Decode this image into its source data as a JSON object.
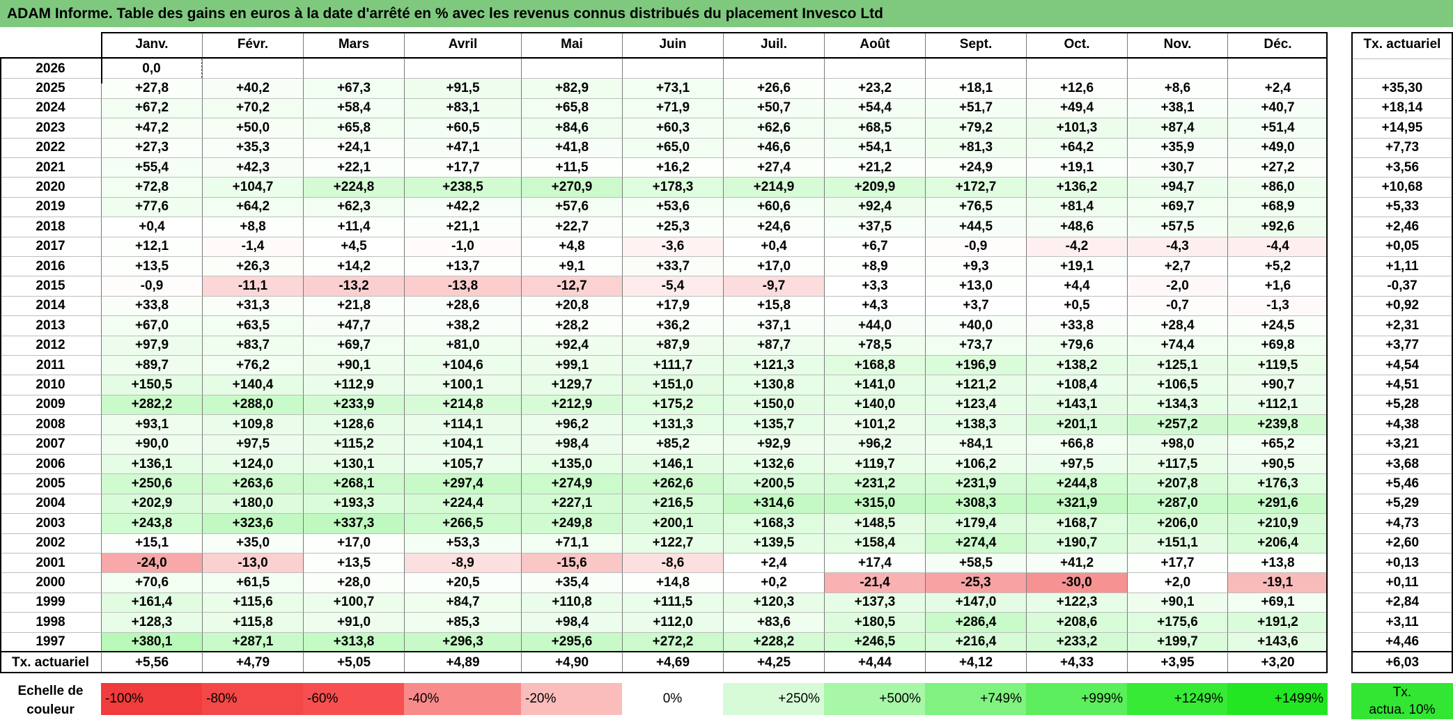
{
  "title": "ADAM Informe. Table des gains en euros à la date d'arrêté en % avec les revenus connus distribués du placement Invesco Ltd",
  "months": [
    "Janv.",
    "Févr.",
    "Mars",
    "Avril",
    "Mai",
    "Juin",
    "Juil.",
    "Août",
    "Sept.",
    "Oct.",
    "Nov.",
    "Déc."
  ],
  "rate_header": "Tx. actuariel",
  "rows": [
    {
      "year": "2026",
      "values": [
        "0,0",
        "",
        "",
        "",
        "",
        "",
        "",
        "",
        "",
        "",
        "",
        ""
      ],
      "rate": ""
    },
    {
      "year": "2025",
      "values": [
        "+27,8",
        "+40,2",
        "+67,3",
        "+91,5",
        "+82,9",
        "+73,1",
        "+26,6",
        "+23,2",
        "+18,1",
        "+12,6",
        "+8,6",
        "+2,4"
      ],
      "rate": "+35,30"
    },
    {
      "year": "2024",
      "values": [
        "+67,2",
        "+70,2",
        "+58,4",
        "+83,1",
        "+65,8",
        "+71,9",
        "+50,7",
        "+54,4",
        "+51,7",
        "+49,4",
        "+38,1",
        "+40,7"
      ],
      "rate": "+18,14"
    },
    {
      "year": "2023",
      "values": [
        "+47,2",
        "+50,0",
        "+65,8",
        "+60,5",
        "+84,6",
        "+60,3",
        "+62,6",
        "+68,5",
        "+79,2",
        "+101,3",
        "+87,4",
        "+51,4"
      ],
      "rate": "+14,95"
    },
    {
      "year": "2022",
      "values": [
        "+27,3",
        "+35,3",
        "+24,1",
        "+47,1",
        "+41,8",
        "+65,0",
        "+46,6",
        "+54,1",
        "+81,3",
        "+64,2",
        "+35,9",
        "+49,0"
      ],
      "rate": "+7,73"
    },
    {
      "year": "2021",
      "values": [
        "+55,4",
        "+42,3",
        "+22,1",
        "+17,7",
        "+11,5",
        "+16,2",
        "+27,4",
        "+21,2",
        "+24,9",
        "+19,1",
        "+30,7",
        "+27,2"
      ],
      "rate": "+3,56"
    },
    {
      "year": "2020",
      "values": [
        "+72,8",
        "+104,7",
        "+224,8",
        "+238,5",
        "+270,9",
        "+178,3",
        "+214,9",
        "+209,9",
        "+172,7",
        "+136,2",
        "+94,7",
        "+86,0"
      ],
      "rate": "+10,68"
    },
    {
      "year": "2019",
      "values": [
        "+77,6",
        "+64,2",
        "+62,3",
        "+42,2",
        "+57,6",
        "+53,6",
        "+60,6",
        "+92,4",
        "+76,5",
        "+81,4",
        "+69,7",
        "+68,9"
      ],
      "rate": "+5,33"
    },
    {
      "year": "2018",
      "values": [
        "+0,4",
        "+8,8",
        "+11,4",
        "+21,1",
        "+22,7",
        "+25,3",
        "+24,6",
        "+37,5",
        "+44,5",
        "+48,6",
        "+57,5",
        "+92,6"
      ],
      "rate": "+2,46"
    },
    {
      "year": "2017",
      "values": [
        "+12,1",
        "-1,4",
        "+4,5",
        "-1,0",
        "+4,8",
        "-3,6",
        "+0,4",
        "+6,7",
        "-0,9",
        "-4,2",
        "-4,3",
        "-4,4"
      ],
      "rate": "+0,05"
    },
    {
      "year": "2016",
      "values": [
        "+13,5",
        "+26,3",
        "+14,2",
        "+13,7",
        "+9,1",
        "+33,7",
        "+17,0",
        "+8,9",
        "+9,3",
        "+19,1",
        "+2,7",
        "+5,2"
      ],
      "rate": "+1,11"
    },
    {
      "year": "2015",
      "values": [
        "-0,9",
        "-11,1",
        "-13,2",
        "-13,8",
        "-12,7",
        "-5,4",
        "-9,7",
        "+3,3",
        "+13,0",
        "+4,4",
        "-2,0",
        "+1,6"
      ],
      "rate": "-0,37"
    },
    {
      "year": "2014",
      "values": [
        "+33,8",
        "+31,3",
        "+21,8",
        "+28,6",
        "+20,8",
        "+17,9",
        "+15,8",
        "+4,3",
        "+3,7",
        "+0,5",
        "-0,7",
        "-1,3"
      ],
      "rate": "+0,92"
    },
    {
      "year": "2013",
      "values": [
        "+67,0",
        "+63,5",
        "+47,7",
        "+38,2",
        "+28,2",
        "+36,2",
        "+37,1",
        "+44,0",
        "+40,0",
        "+33,8",
        "+28,4",
        "+24,5"
      ],
      "rate": "+2,31"
    },
    {
      "year": "2012",
      "values": [
        "+97,9",
        "+83,7",
        "+69,7",
        "+81,0",
        "+92,4",
        "+87,9",
        "+87,7",
        "+78,5",
        "+73,7",
        "+79,6",
        "+74,4",
        "+69,8"
      ],
      "rate": "+3,77"
    },
    {
      "year": "2011",
      "values": [
        "+89,7",
        "+76,2",
        "+90,1",
        "+104,6",
        "+99,1",
        "+111,7",
        "+121,3",
        "+168,8",
        "+196,9",
        "+138,2",
        "+125,1",
        "+119,5"
      ],
      "rate": "+4,54"
    },
    {
      "year": "2010",
      "values": [
        "+150,5",
        "+140,4",
        "+112,9",
        "+100,1",
        "+129,7",
        "+151,0",
        "+130,8",
        "+141,0",
        "+121,2",
        "+108,4",
        "+106,5",
        "+90,7"
      ],
      "rate": "+4,51"
    },
    {
      "year": "2009",
      "values": [
        "+282,2",
        "+288,0",
        "+233,9",
        "+214,8",
        "+212,9",
        "+175,2",
        "+150,0",
        "+140,0",
        "+123,4",
        "+143,1",
        "+134,3",
        "+112,1"
      ],
      "rate": "+5,28"
    },
    {
      "year": "2008",
      "values": [
        "+93,1",
        "+109,8",
        "+128,6",
        "+114,1",
        "+96,2",
        "+131,3",
        "+135,7",
        "+101,2",
        "+138,3",
        "+201,1",
        "+257,2",
        "+239,8"
      ],
      "rate": "+4,38"
    },
    {
      "year": "2007",
      "values": [
        "+90,0",
        "+97,5",
        "+115,2",
        "+104,1",
        "+98,4",
        "+85,2",
        "+92,9",
        "+96,2",
        "+84,1",
        "+66,8",
        "+98,0",
        "+65,2"
      ],
      "rate": "+3,21"
    },
    {
      "year": "2006",
      "values": [
        "+136,1",
        "+124,0",
        "+130,1",
        "+105,7",
        "+135,0",
        "+146,1",
        "+132,6",
        "+119,7",
        "+106,2",
        "+97,5",
        "+117,5",
        "+90,5"
      ],
      "rate": "+3,68"
    },
    {
      "year": "2005",
      "values": [
        "+250,6",
        "+263,6",
        "+268,1",
        "+297,4",
        "+274,9",
        "+262,6",
        "+200,5",
        "+231,2",
        "+231,9",
        "+244,8",
        "+207,8",
        "+176,3"
      ],
      "rate": "+5,46"
    },
    {
      "year": "2004",
      "values": [
        "+202,9",
        "+180,0",
        "+193,3",
        "+224,4",
        "+227,1",
        "+216,5",
        "+314,6",
        "+315,0",
        "+308,3",
        "+321,9",
        "+287,0",
        "+291,6"
      ],
      "rate": "+5,29"
    },
    {
      "year": "2003",
      "values": [
        "+243,8",
        "+323,6",
        "+337,3",
        "+266,5",
        "+249,8",
        "+200,1",
        "+168,3",
        "+148,5",
        "+179,4",
        "+168,7",
        "+206,0",
        "+210,9"
      ],
      "rate": "+4,73"
    },
    {
      "year": "2002",
      "values": [
        "+15,1",
        "+35,0",
        "+17,0",
        "+53,3",
        "+71,1",
        "+122,7",
        "+139,5",
        "+158,4",
        "+274,4",
        "+190,7",
        "+151,1",
        "+206,4"
      ],
      "rate": "+2,60"
    },
    {
      "year": "2001",
      "values": [
        "-24,0",
        "-13,0",
        "+13,5",
        "-8,9",
        "-15,6",
        "-8,6",
        "+2,4",
        "+17,4",
        "+58,5",
        "+41,2",
        "+17,7",
        "+13,8"
      ],
      "rate": "+0,13"
    },
    {
      "year": "2000",
      "values": [
        "+70,6",
        "+61,5",
        "+28,0",
        "+20,5",
        "+35,4",
        "+14,8",
        "+0,2",
        "-21,4",
        "-25,3",
        "-30,0",
        "+2,0",
        "-19,1"
      ],
      "rate": "+0,11"
    },
    {
      "year": "1999",
      "values": [
        "+161,4",
        "+115,6",
        "+100,7",
        "+84,7",
        "+110,8",
        "+111,5",
        "+120,3",
        "+137,3",
        "+147,0",
        "+122,3",
        "+90,1",
        "+69,1"
      ],
      "rate": "+2,84"
    },
    {
      "year": "1998",
      "values": [
        "+128,3",
        "+115,8",
        "+91,0",
        "+85,3",
        "+98,4",
        "+112,0",
        "+83,6",
        "+180,5",
        "+286,4",
        "+208,6",
        "+175,6",
        "+191,2"
      ],
      "rate": "+3,11"
    },
    {
      "year": "1997",
      "values": [
        "+380,1",
        "+287,1",
        "+313,8",
        "+296,3",
        "+295,6",
        "+272,2",
        "+228,2",
        "+246,5",
        "+216,4",
        "+233,2",
        "+199,7",
        "+143,6"
      ],
      "rate": "+4,46"
    }
  ],
  "footer": {
    "label": "Tx. actuariel",
    "values": [
      "+5,56",
      "+4,79",
      "+5,05",
      "+4,89",
      "+4,90",
      "+4,69",
      "+4,25",
      "+4,44",
      "+4,12",
      "+4,33",
      "+3,95",
      "+3,20"
    ],
    "rate": "+6,03"
  },
  "scale": {
    "label_line1": "Echelle de",
    "label_line2": "couleur",
    "items": [
      {
        "label": "-100%",
        "color": "#f03c3c",
        "align": "left"
      },
      {
        "label": "-80%",
        "color": "#f44848",
        "align": "left"
      },
      {
        "label": "-60%",
        "color": "#f74f4f",
        "align": "left"
      },
      {
        "label": "-40%",
        "color": "#f98a8a",
        "align": "left"
      },
      {
        "label": "-20%",
        "color": "#fbbcbc",
        "align": "left"
      },
      {
        "label": "0%",
        "color": "#ffffff",
        "align": "center"
      },
      {
        "label": "+250%",
        "color": "#d6fbd6",
        "align": "right"
      },
      {
        "label": "+500%",
        "color": "#a8f7a8",
        "align": "right"
      },
      {
        "label": "+749%",
        "color": "#7ff27f",
        "align": "right"
      },
      {
        "label": "+999%",
        "color": "#5cee5c",
        "align": "right"
      },
      {
        "label": "+1249%",
        "color": "#36ea36",
        "align": "right"
      },
      {
        "label": "+1499%",
        "color": "#22e622",
        "align": "right"
      }
    ],
    "rate_line1": "Tx.",
    "rate_line2": "actua. 10%",
    "rate_color": "#33e633"
  }
}
